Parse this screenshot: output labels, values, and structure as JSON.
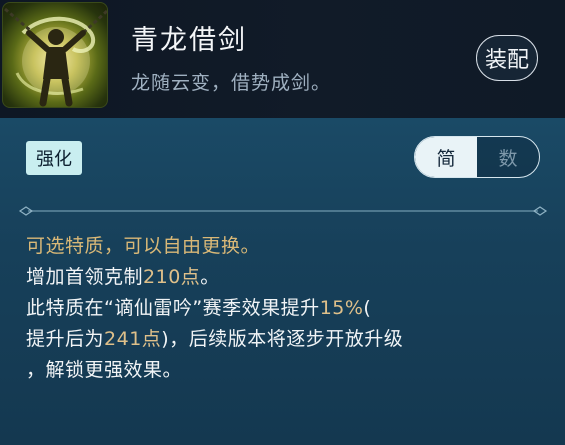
{
  "skill": {
    "name": "青龙借剑",
    "tagline": "龙随云变，借势成剑。",
    "equip_label": "装配",
    "icon": "dragon-swordsman-icon"
  },
  "tabs": {
    "enhance_label": "强化",
    "simple_label": "简",
    "numbers_label": "数",
    "active": "简"
  },
  "description": {
    "line1": "可选特质，可以自由更换。",
    "line2_pre": "增加首领克制",
    "line2_val": "210点",
    "line2_post": "。",
    "line3_pre": "此特质在“谪仙雷吟”赛季效果提升",
    "line3_val": "15%",
    "line3_post": "(",
    "line4_pre": "提升后为",
    "line4_val": "241点",
    "line4_post": ")，后续版本将逐步开放升级",
    "line5": "，解锁更强效果。"
  },
  "colors": {
    "header_bg": "#0e1724",
    "panel_bg": "#17405a",
    "highlight": "#dfc08a",
    "tag_bg": "#c9eef0"
  }
}
